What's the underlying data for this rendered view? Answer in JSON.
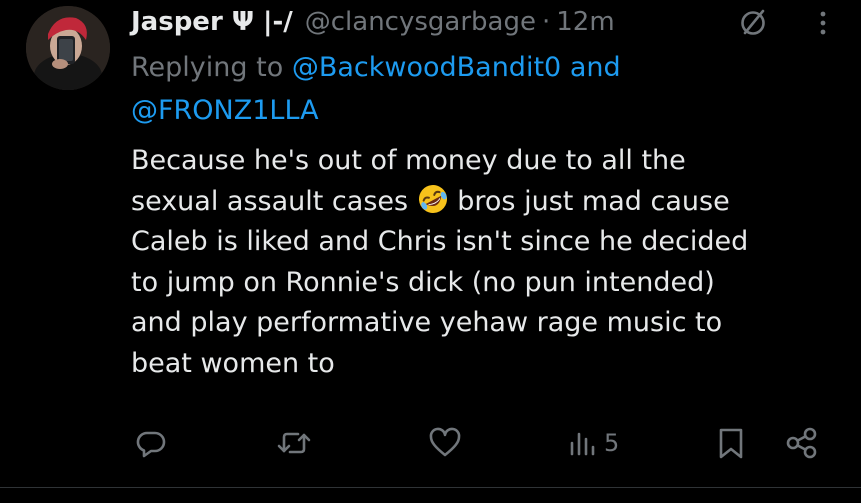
{
  "tweet": {
    "display_name": "Jasper Ψ |-/",
    "handle": "@clancysgarbage",
    "separator": "·",
    "time": "12m",
    "replying_prefix": "Replying to",
    "mentions": [
      "@BackwoodBandit0",
      "@FRONZ1LLA"
    ],
    "mention_joiner": "and",
    "body_lines": [
      "Because he's out of money due to all the",
      "sexual assault cases",
      "bros just mad cause",
      "Caleb is liked and Chris isn't since he decided",
      "to jump on Ronnie's dick (no pun intended)",
      "and play performative yehaw rage music to",
      "beat women to"
    ],
    "emoji": "rolling-on-floor-laughing-emoji"
  },
  "actions": {
    "reply_count": "",
    "retweet_count": "",
    "like_count": "",
    "view_count": "5"
  },
  "icons": {
    "header": [
      "no-notifications-icon",
      "more-options-icon"
    ],
    "actions": [
      "reply-icon",
      "retweet-icon",
      "like-icon",
      "views-icon",
      "bookmark-icon",
      "share-icon"
    ]
  },
  "colors": {
    "background": "#000000",
    "text": "#e7e9ea",
    "muted": "#71767b",
    "accent": "#1d9bf0",
    "divider": "#2f3336"
  }
}
